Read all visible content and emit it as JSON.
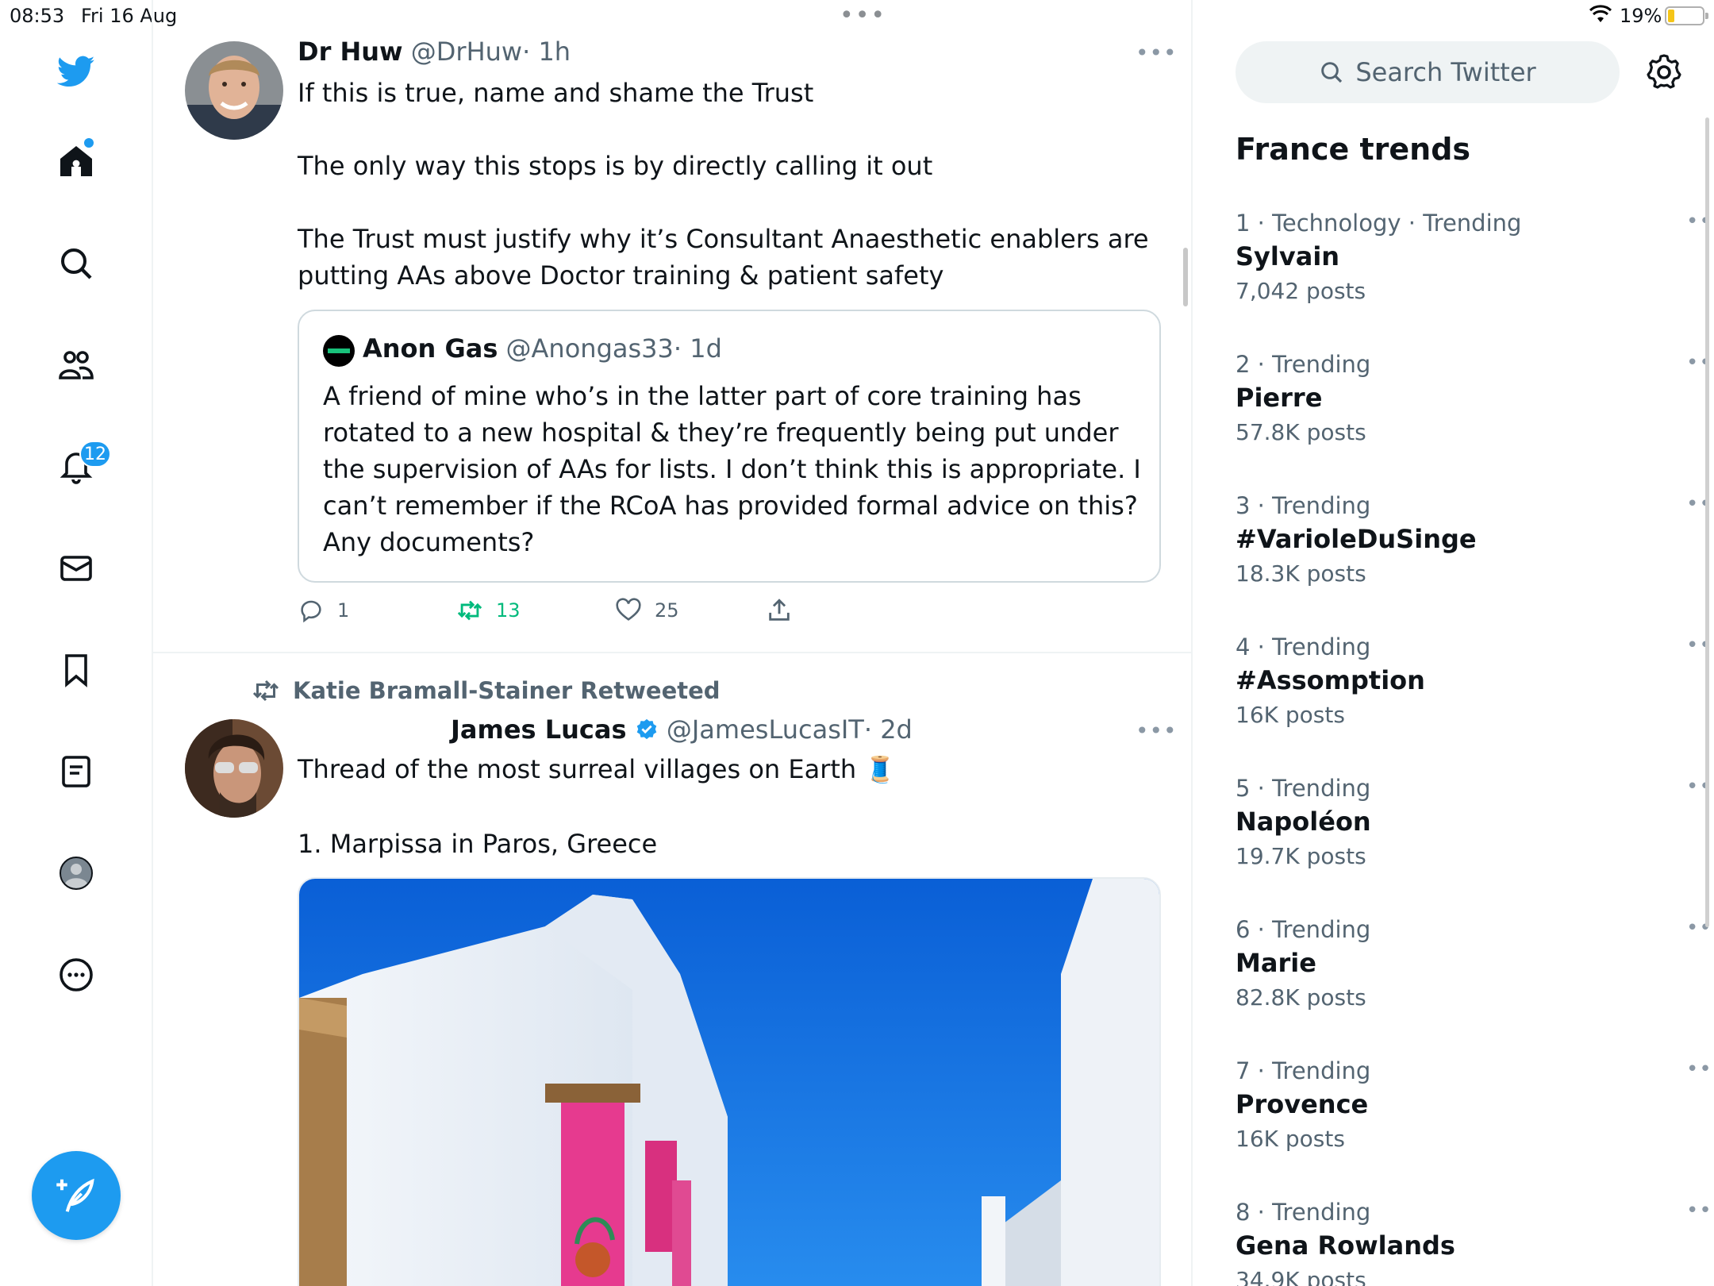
{
  "status_bar": {
    "time": "08:53",
    "date": "Fri 16 Aug",
    "battery_pct": "19%",
    "battery_level": 0.19
  },
  "nav": {
    "notifications_badge": "12",
    "items": [
      "twitter-logo",
      "home-icon",
      "search-icon",
      "communities-icon",
      "notifications-icon",
      "messages-icon",
      "bookmarks-icon",
      "lists-icon",
      "profile-icon",
      "more-icon"
    ]
  },
  "tweet1": {
    "name": "Dr Huw",
    "handle": "@DrHuw",
    "time": "· 1h",
    "body": "If this is true, name and shame the Trust\n\nThe only way this stops is by directly calling it out\n\nThe Trust must justify why it’s Consultant Anaesthetic enablers are\nputting AAs above Doctor training & patient safety",
    "quote": {
      "name": "Anon Gas",
      "handle": "@Anongas33",
      "time": "· 1d",
      "body": "A friend of mine who’s in the latter part of core training has rotated to a new hospital & they’re frequently being put under the supervision of AAs for lists. I don’t think this is appropriate. I can’t remember if the RCoA has provided formal advice on this? Any documents?"
    },
    "replies": "1",
    "retweets": "13",
    "likes": "25"
  },
  "tweet2": {
    "retweeted_by": "Katie Bramall-Stainer Retweeted",
    "name": "James Lucas",
    "handle": "@JamesLucasIT",
    "time": "· 2d",
    "body_line1": "Thread of the most surreal villages on Earth 🧵",
    "body_line2": "1. Marpissa in Paros, Greece"
  },
  "sidebar": {
    "search_placeholder": "Search Twitter",
    "title": "France trends",
    "trends": [
      {
        "meta": "1 · Technology · Trending",
        "name": "Sylvain",
        "count": "7,042 posts"
      },
      {
        "meta": "2 · Trending",
        "name": "Pierre",
        "count": "57.8K posts"
      },
      {
        "meta": "3 · Trending",
        "name": "#VarioleDuSinge",
        "count": "18.3K posts"
      },
      {
        "meta": "4 · Trending",
        "name": "#Assomption",
        "count": "16K posts"
      },
      {
        "meta": "5 · Trending",
        "name": "Napoléon",
        "count": "19.7K posts"
      },
      {
        "meta": "6 · Trending",
        "name": "Marie",
        "count": "82.8K posts"
      },
      {
        "meta": "7 · Trending",
        "name": "Provence",
        "count": "16K posts"
      },
      {
        "meta": "8 · Trending",
        "name": "Gena Rowlands",
        "count": "34.9K posts"
      }
    ]
  },
  "colors": {
    "accent": "#1d9bf0",
    "retweet": "#00ba7c",
    "secondary_text": "#536471"
  }
}
